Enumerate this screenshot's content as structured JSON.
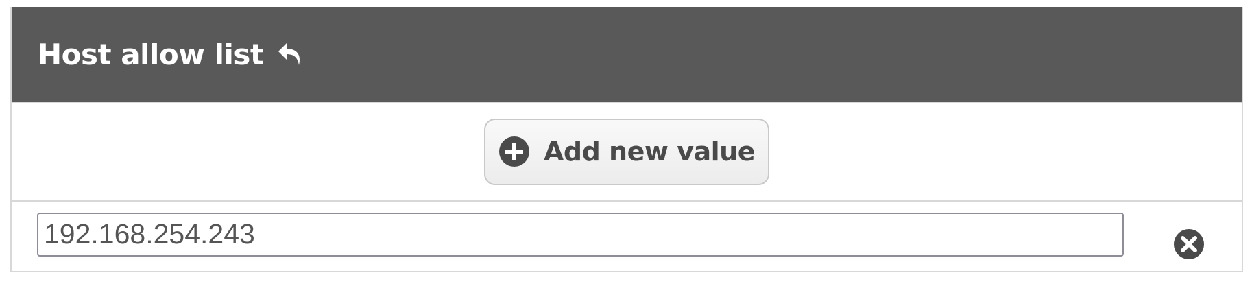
{
  "header": {
    "title": "Host allow list",
    "undo_icon": "undo-arrow-icon"
  },
  "toolbar": {
    "add_label": "Add new value",
    "add_icon": "plus-circle-icon"
  },
  "values": [
    {
      "value": "192.168.254.243",
      "remove_icon": "close-circle-icon"
    }
  ],
  "colors": {
    "header_bg": "#595959",
    "header_text": "#ffffff",
    "icon_dark": "#4a4a4a",
    "border": "#d8d8d8"
  }
}
